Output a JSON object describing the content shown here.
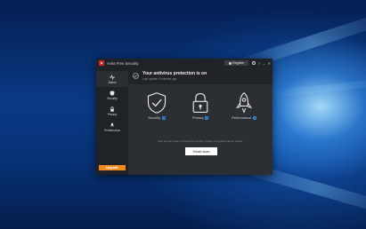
{
  "app": {
    "title": "Avira Free Security",
    "logo_letter": "a"
  },
  "titlebar": {
    "register_label": "Register",
    "help_symbol": "?",
    "minimize_symbol": "–",
    "close_symbol": "✕"
  },
  "sidebar": {
    "items": [
      {
        "label": "Status",
        "icon": "pulse-icon",
        "active": true
      },
      {
        "label": "Security",
        "icon": "shield-icon",
        "active": false
      },
      {
        "label": "Privacy",
        "icon": "lock-icon",
        "active": false
      },
      {
        "label": "Performance",
        "icon": "rocket-icon",
        "active": false
      }
    ],
    "upgrade_label": "Upgrade"
  },
  "status": {
    "title": "Your antivirus protection is on",
    "subtitle": "Last update: 5 minutes ago"
  },
  "features": [
    {
      "label": "Security",
      "icon": "shield-check-icon"
    },
    {
      "label": "Privacy",
      "icon": "padlock-icon"
    },
    {
      "label": "Performance",
      "icon": "rocket-icon"
    }
  ],
  "hint": "Run a smart scan to check for security, privacy and performance issues",
  "scan_button": "Smart scan",
  "colors": {
    "accent_orange": "#f08a1c",
    "brand_red": "#d4242e",
    "info_blue": "#3aa0ff",
    "window_bg": "#2b2f33",
    "sidebar_bg": "#1f2226"
  }
}
